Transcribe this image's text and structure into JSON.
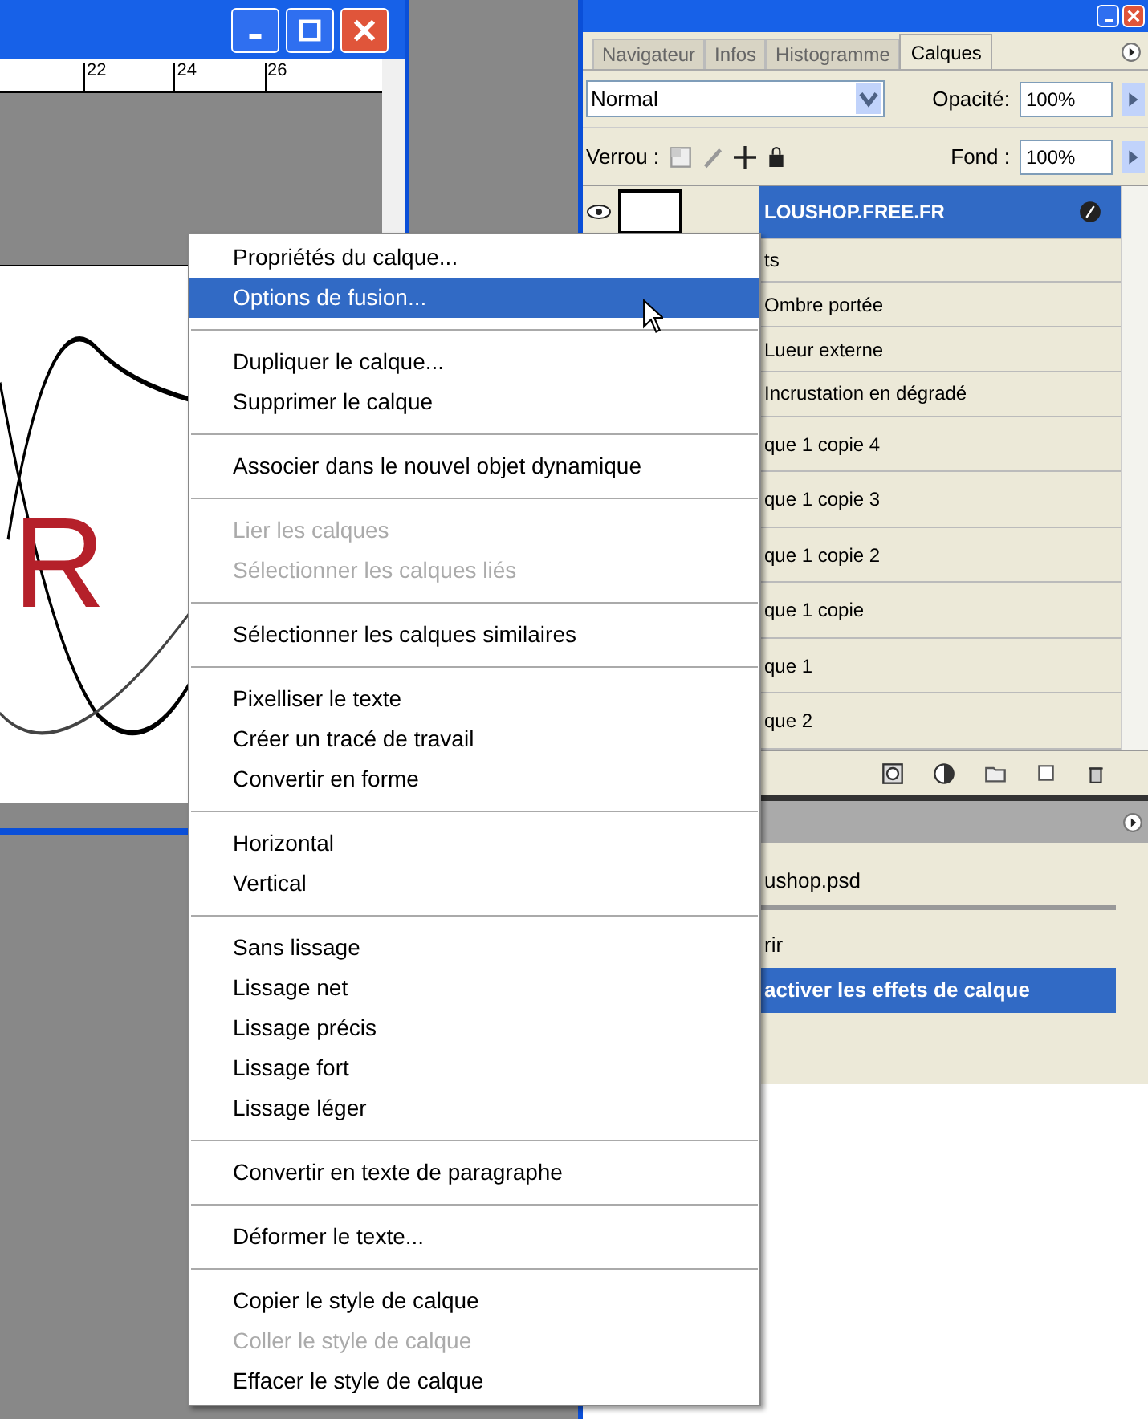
{
  "document": {
    "ruler_labels": [
      "22",
      "24",
      "26"
    ],
    "canvas_letter": "R"
  },
  "panel": {
    "tabs": [
      {
        "label": "Navigateur",
        "selected": false
      },
      {
        "label": "Infos",
        "selected": false
      },
      {
        "label": "Histogramme",
        "selected": false
      },
      {
        "label": "Calques",
        "selected": true
      }
    ],
    "blend_mode": "Normal",
    "opacity_label": "Opacité:",
    "opacity_value": "100%",
    "lock_label": "Verrou :",
    "fill_label": "Fond :",
    "fill_value": "100%",
    "layers": [
      {
        "kind": "layer",
        "label": "LOUSHOP.FREE.FR",
        "selected": true
      },
      {
        "kind": "effects",
        "label": "ts",
        "selected": false
      },
      {
        "kind": "effect",
        "label": "Ombre portée",
        "selected": false
      },
      {
        "kind": "effect",
        "label": "Lueur externe",
        "selected": false
      },
      {
        "kind": "effect",
        "label": "Incrustation en dégradé",
        "selected": false
      },
      {
        "kind": "layer",
        "label": "que 1 copie 4",
        "selected": false
      },
      {
        "kind": "layer",
        "label": "que 1 copie 3",
        "selected": false
      },
      {
        "kind": "layer",
        "label": "que 1 copie 2",
        "selected": false
      },
      {
        "kind": "layer",
        "label": "que 1 copie",
        "selected": false
      },
      {
        "kind": "layer",
        "label": "que 1",
        "selected": false
      },
      {
        "kind": "layer",
        "label": "que 2",
        "selected": false
      }
    ]
  },
  "history": {
    "items": [
      {
        "kind": "snapshot",
        "label": "ushop.psd",
        "selected": false
      },
      {
        "kind": "step",
        "label": "rir",
        "selected": false
      },
      {
        "kind": "step",
        "label": "activer les effets de calque",
        "selected": true
      }
    ]
  },
  "context_menu": {
    "sections": [
      [
        {
          "label": "Propriétés du calque...",
          "disabled": false,
          "selected": false
        },
        {
          "label": "Options de fusion...",
          "disabled": false,
          "selected": true
        }
      ],
      [
        {
          "label": "Dupliquer le calque...",
          "disabled": false,
          "selected": false
        },
        {
          "label": "Supprimer le calque",
          "disabled": false,
          "selected": false
        }
      ],
      [
        {
          "label": "Associer dans le nouvel objet dynamique",
          "disabled": false,
          "selected": false
        }
      ],
      [
        {
          "label": "Lier les calques",
          "disabled": true,
          "selected": false
        },
        {
          "label": "Sélectionner les calques liés",
          "disabled": true,
          "selected": false
        }
      ],
      [
        {
          "label": "Sélectionner les calques similaires",
          "disabled": false,
          "selected": false
        }
      ],
      [
        {
          "label": "Pixelliser le texte",
          "disabled": false,
          "selected": false
        },
        {
          "label": "Créer un tracé de travail",
          "disabled": false,
          "selected": false
        },
        {
          "label": "Convertir en forme",
          "disabled": false,
          "selected": false
        }
      ],
      [
        {
          "label": "Horizontal",
          "disabled": false,
          "selected": false
        },
        {
          "label": "Vertical",
          "disabled": false,
          "selected": false
        }
      ],
      [
        {
          "label": "Sans lissage",
          "disabled": false,
          "selected": false
        },
        {
          "label": "Lissage net",
          "disabled": false,
          "selected": false
        },
        {
          "label": "Lissage précis",
          "disabled": false,
          "selected": false
        },
        {
          "label": "Lissage fort",
          "disabled": false,
          "selected": false
        },
        {
          "label": "Lissage léger",
          "disabled": false,
          "selected": false
        }
      ],
      [
        {
          "label": "Convertir en texte de paragraphe",
          "disabled": false,
          "selected": false
        }
      ],
      [
        {
          "label": "Déformer le texte...",
          "disabled": false,
          "selected": false
        }
      ],
      [
        {
          "label": "Copier le style de calque",
          "disabled": false,
          "selected": false
        },
        {
          "label": "Coller le style de calque",
          "disabled": true,
          "selected": false
        },
        {
          "label": "Effacer le style de calque",
          "disabled": false,
          "selected": false
        }
      ]
    ]
  }
}
